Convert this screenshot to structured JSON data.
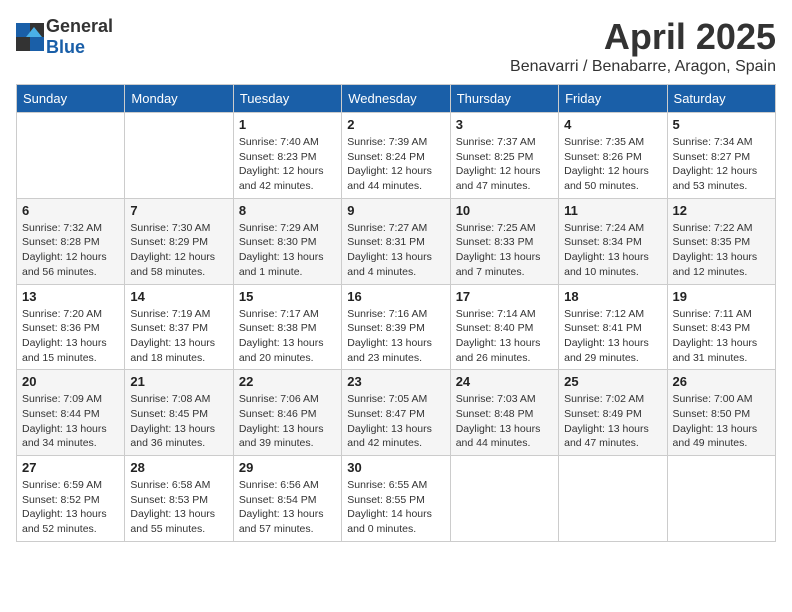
{
  "header": {
    "logo_general": "General",
    "logo_blue": "Blue",
    "month": "April 2025",
    "location": "Benavarri / Benabarre, Aragon, Spain"
  },
  "weekdays": [
    "Sunday",
    "Monday",
    "Tuesday",
    "Wednesday",
    "Thursday",
    "Friday",
    "Saturday"
  ],
  "weeks": [
    [
      {
        "day": "",
        "info": ""
      },
      {
        "day": "",
        "info": ""
      },
      {
        "day": "1",
        "info": "Sunrise: 7:40 AM\nSunset: 8:23 PM\nDaylight: 12 hours and 42 minutes."
      },
      {
        "day": "2",
        "info": "Sunrise: 7:39 AM\nSunset: 8:24 PM\nDaylight: 12 hours and 44 minutes."
      },
      {
        "day": "3",
        "info": "Sunrise: 7:37 AM\nSunset: 8:25 PM\nDaylight: 12 hours and 47 minutes."
      },
      {
        "day": "4",
        "info": "Sunrise: 7:35 AM\nSunset: 8:26 PM\nDaylight: 12 hours and 50 minutes."
      },
      {
        "day": "5",
        "info": "Sunrise: 7:34 AM\nSunset: 8:27 PM\nDaylight: 12 hours and 53 minutes."
      }
    ],
    [
      {
        "day": "6",
        "info": "Sunrise: 7:32 AM\nSunset: 8:28 PM\nDaylight: 12 hours and 56 minutes."
      },
      {
        "day": "7",
        "info": "Sunrise: 7:30 AM\nSunset: 8:29 PM\nDaylight: 12 hours and 58 minutes."
      },
      {
        "day": "8",
        "info": "Sunrise: 7:29 AM\nSunset: 8:30 PM\nDaylight: 13 hours and 1 minute."
      },
      {
        "day": "9",
        "info": "Sunrise: 7:27 AM\nSunset: 8:31 PM\nDaylight: 13 hours and 4 minutes."
      },
      {
        "day": "10",
        "info": "Sunrise: 7:25 AM\nSunset: 8:33 PM\nDaylight: 13 hours and 7 minutes."
      },
      {
        "day": "11",
        "info": "Sunrise: 7:24 AM\nSunset: 8:34 PM\nDaylight: 13 hours and 10 minutes."
      },
      {
        "day": "12",
        "info": "Sunrise: 7:22 AM\nSunset: 8:35 PM\nDaylight: 13 hours and 12 minutes."
      }
    ],
    [
      {
        "day": "13",
        "info": "Sunrise: 7:20 AM\nSunset: 8:36 PM\nDaylight: 13 hours and 15 minutes."
      },
      {
        "day": "14",
        "info": "Sunrise: 7:19 AM\nSunset: 8:37 PM\nDaylight: 13 hours and 18 minutes."
      },
      {
        "day": "15",
        "info": "Sunrise: 7:17 AM\nSunset: 8:38 PM\nDaylight: 13 hours and 20 minutes."
      },
      {
        "day": "16",
        "info": "Sunrise: 7:16 AM\nSunset: 8:39 PM\nDaylight: 13 hours and 23 minutes."
      },
      {
        "day": "17",
        "info": "Sunrise: 7:14 AM\nSunset: 8:40 PM\nDaylight: 13 hours and 26 minutes."
      },
      {
        "day": "18",
        "info": "Sunrise: 7:12 AM\nSunset: 8:41 PM\nDaylight: 13 hours and 29 minutes."
      },
      {
        "day": "19",
        "info": "Sunrise: 7:11 AM\nSunset: 8:43 PM\nDaylight: 13 hours and 31 minutes."
      }
    ],
    [
      {
        "day": "20",
        "info": "Sunrise: 7:09 AM\nSunset: 8:44 PM\nDaylight: 13 hours and 34 minutes."
      },
      {
        "day": "21",
        "info": "Sunrise: 7:08 AM\nSunset: 8:45 PM\nDaylight: 13 hours and 36 minutes."
      },
      {
        "day": "22",
        "info": "Sunrise: 7:06 AM\nSunset: 8:46 PM\nDaylight: 13 hours and 39 minutes."
      },
      {
        "day": "23",
        "info": "Sunrise: 7:05 AM\nSunset: 8:47 PM\nDaylight: 13 hours and 42 minutes."
      },
      {
        "day": "24",
        "info": "Sunrise: 7:03 AM\nSunset: 8:48 PM\nDaylight: 13 hours and 44 minutes."
      },
      {
        "day": "25",
        "info": "Sunrise: 7:02 AM\nSunset: 8:49 PM\nDaylight: 13 hours and 47 minutes."
      },
      {
        "day": "26",
        "info": "Sunrise: 7:00 AM\nSunset: 8:50 PM\nDaylight: 13 hours and 49 minutes."
      }
    ],
    [
      {
        "day": "27",
        "info": "Sunrise: 6:59 AM\nSunset: 8:52 PM\nDaylight: 13 hours and 52 minutes."
      },
      {
        "day": "28",
        "info": "Sunrise: 6:58 AM\nSunset: 8:53 PM\nDaylight: 13 hours and 55 minutes."
      },
      {
        "day": "29",
        "info": "Sunrise: 6:56 AM\nSunset: 8:54 PM\nDaylight: 13 hours and 57 minutes."
      },
      {
        "day": "30",
        "info": "Sunrise: 6:55 AM\nSunset: 8:55 PM\nDaylight: 14 hours and 0 minutes."
      },
      {
        "day": "",
        "info": ""
      },
      {
        "day": "",
        "info": ""
      },
      {
        "day": "",
        "info": ""
      }
    ]
  ]
}
